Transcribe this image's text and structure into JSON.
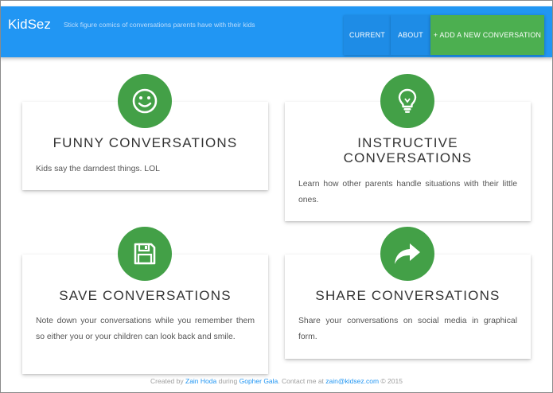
{
  "header": {
    "brand": "KidSez",
    "tagline": "Stick figure comics of conversations parents have with their kids",
    "nav": {
      "current": "CURRENT",
      "about": "ABOUT",
      "add": "+ ADD A NEW CONVERSATION"
    }
  },
  "cards": [
    {
      "icon": "smiley-icon",
      "title": "FUNNY CONVERSATIONS",
      "text": "Kids say the darndest things. LOL"
    },
    {
      "icon": "lightbulb-icon",
      "title_line1": "INSTRUCTIVE",
      "title_line2": "CONVERSATIONS",
      "text": "Learn how other parents handle situations with their little ones."
    },
    {
      "icon": "floppy-disk-icon",
      "title": "SAVE CONVERSATIONS",
      "text": "Note down your conversations while you remember them so either you or your children can look back and smile."
    },
    {
      "icon": "share-arrow-icon",
      "title": "SHARE CONVERSATIONS",
      "text": "Share your conversations on social media in graphical form."
    }
  ],
  "footer": {
    "created_by": "Created by",
    "author": "Zain Hoda",
    "during": "during",
    "event": "Gopher Gala",
    "contact": ". Contact me at",
    "email": "zain@kidsez.com",
    "copyright": "© 2015"
  },
  "colors": {
    "primary": "#2196f3",
    "accent": "#4caf50",
    "icon_circle": "#43a047"
  }
}
